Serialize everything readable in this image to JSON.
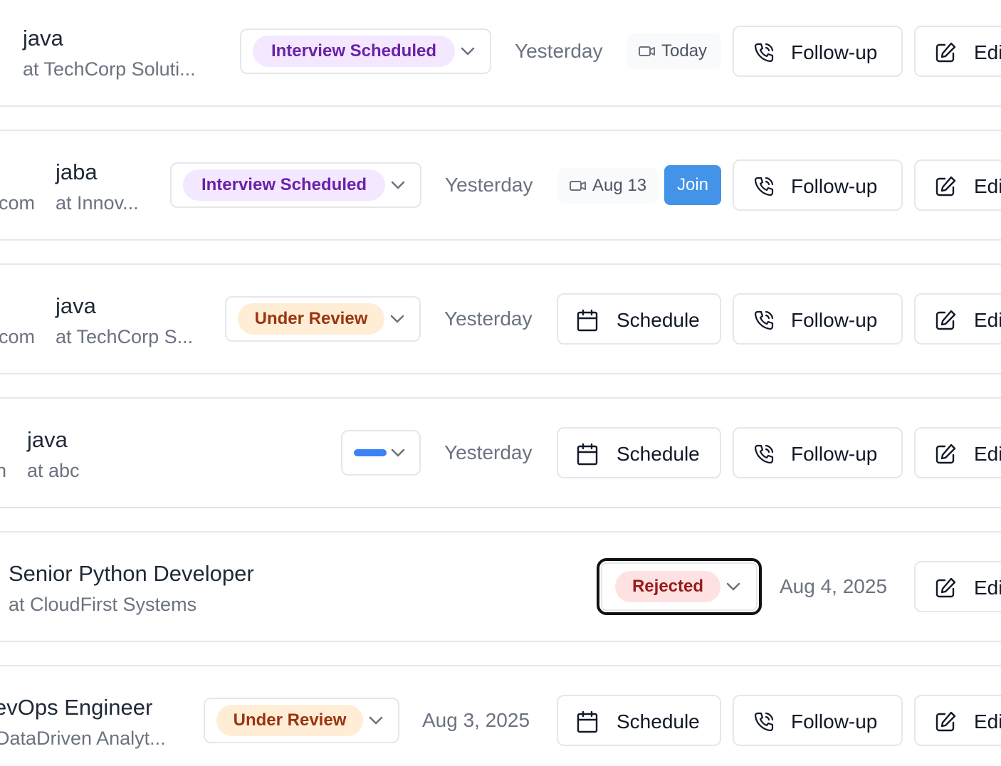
{
  "rows": [
    {
      "title": "java",
      "company": "at TechCorp Soluti...",
      "status": "Interview Scheduled",
      "applied": "Yesterday",
      "interview": "Today",
      "followup": "Follow-up",
      "edit": "Edi"
    },
    {
      "email_fragment": "com",
      "title": "jaba",
      "company": "at Innov...",
      "status": "Interview Scheduled",
      "applied": "Yesterday",
      "interview": "Aug 13",
      "join": "Join",
      "followup": "Follow-up",
      "edit": "Edi"
    },
    {
      "email_fragment": "com",
      "title": "java",
      "company": "at TechCorp S...",
      "status": "Under Review",
      "applied": "Yesterday",
      "schedule": "Schedule",
      "followup": "Follow-up",
      "edit": "Edi"
    },
    {
      "email_fragment": "n",
      "title": "java",
      "company": "at abc",
      "status": "",
      "status_color": "#3b82f6",
      "applied": "Yesterday",
      "schedule": "Schedule",
      "followup": "Follow-up",
      "edit": "Edi"
    },
    {
      "title": "Senior Python Developer",
      "company": "at CloudFirst Systems",
      "status": "Rejected",
      "applied": "Aug 4, 2025",
      "edit": "Edi"
    },
    {
      "title": "evOps Engineer",
      "company": "DataDriven Analyt...",
      "status": "Under Review",
      "applied": "Aug 3, 2025",
      "schedule": "Schedule",
      "followup": "Follow-up",
      "edit": "Edi"
    }
  ],
  "colors": {
    "purple_badge_bg": "#f3e8ff",
    "purple_badge_text": "#6b21a8",
    "orange_badge_bg": "#ffedd5",
    "orange_badge_text": "#9a3412",
    "red_badge_bg": "#fee2e2",
    "red_badge_text": "#991b1b",
    "join_button": "#4393e9"
  }
}
